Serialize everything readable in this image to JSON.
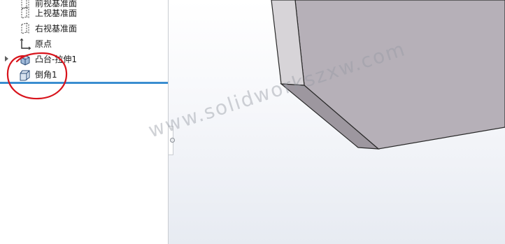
{
  "feature_tree": {
    "items": [
      {
        "label": "前视基准面",
        "icon": "plane-icon",
        "expandable": false
      },
      {
        "label": "上视基准面",
        "icon": "plane-icon",
        "expandable": false
      },
      {
        "label": "右视基准面",
        "icon": "plane-icon",
        "expandable": false
      },
      {
        "label": "原点",
        "icon": "origin-icon",
        "expandable": false
      },
      {
        "label": "凸台-拉伸1",
        "icon": "boss-extrude-icon",
        "expandable": true
      },
      {
        "label": "倒角1",
        "icon": "chamfer-icon",
        "expandable": false
      }
    ],
    "highlight_color": "#d8141c",
    "rollback_bar_color": "#3b8ed0"
  },
  "graphics_area": {
    "part_face_color": "#b6b0b8",
    "chamfer_face_color": "#d5d2d6",
    "watermark": "www.solidworkszxw.com"
  }
}
